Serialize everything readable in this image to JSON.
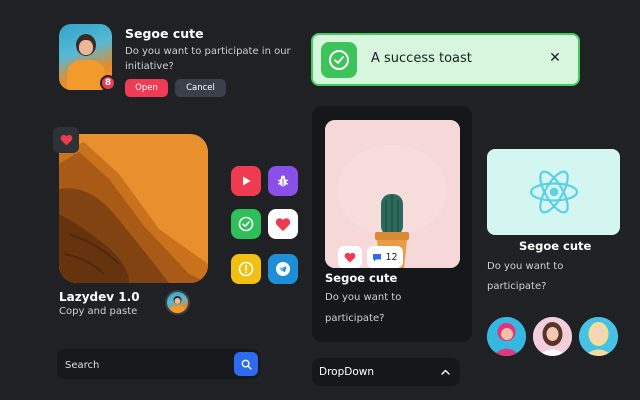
{
  "notification": {
    "title": "Segoe cute",
    "message": "Do you want to participate in our initiative?",
    "badge_count": "8",
    "open_label": "Open",
    "cancel_label": "Cancel"
  },
  "toast": {
    "message": "A success toast",
    "close_glyph": "✕"
  },
  "dune_card": {
    "title": "Lazydev 1.0",
    "subtitle": "Copy and paste"
  },
  "app_icons": [
    {
      "icon": "play-icon",
      "color": "#ef3b4f"
    },
    {
      "icon": "bug-icon",
      "color": "#8a4fe8"
    },
    {
      "icon": "check-icon",
      "color": "#2fbf5a"
    },
    {
      "icon": "heart-icon",
      "color": "#ffffff"
    },
    {
      "icon": "alert-icon",
      "color": "#f2c012"
    },
    {
      "icon": "telegram-icon",
      "color": "#1e8fd6"
    }
  ],
  "search": {
    "placeholder": "Search"
  },
  "product_card": {
    "like_count": "12",
    "title": "Segoe cute",
    "text": "Do you want to participate?"
  },
  "dropdown": {
    "label": "DropDown"
  },
  "react_card": {
    "title": "Segoe cute",
    "text": "Do you want to participate?"
  },
  "colors": {
    "background": "#202124",
    "accent_red": "#ef3b55",
    "success_green": "#3cc35a",
    "search_blue": "#2f6bf0",
    "react_blue": "#5ccfe6"
  }
}
